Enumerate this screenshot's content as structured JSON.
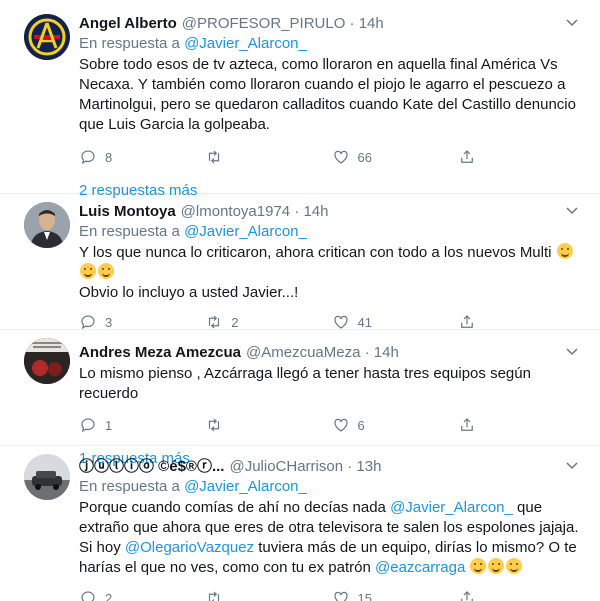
{
  "tweets": [
    {
      "name": "Angel Alberto",
      "handle": "@PROFESOR_PIRULO · 14h",
      "reply_prefix": "En respuesta a",
      "reply_to": "@Javier_Alarcon_",
      "text": "Sobre todo esos de tv azteca, como lloraron en aquella final América Vs Necaxa. Y también como lloraron cuando el piojo le agarro el pescuezo a Martinolgui, pero se quedaron calladitos cuando Kate del Castillo denuncio que Luis Garcia la golpeaba.",
      "replies": "8",
      "retweets": "",
      "likes": "66",
      "more": "2 respuestas más",
      "avatar_icon": "club-america-crest-icon"
    },
    {
      "name": "Luis Montoya",
      "handle": "@lmontoya1974 · 14h",
      "reply_prefix": "En respuesta a",
      "reply_to": "@Javier_Alarcon_",
      "line1": "Y los que nunca lo criticaron, ahora critican con todo a los nuevos Multi",
      "line2": "Obvio lo incluyo a usted Javier...!",
      "replies": "3",
      "retweets": "2",
      "likes": "41",
      "emoji": "grinning-face-emoji"
    },
    {
      "name": "Andres Meza Amezcua",
      "handle": "@AmezcuaMeza · 14h",
      "text": "Lo mismo pienso , Azcárraga llegó a tener hasta tres equipos según recuerdo",
      "replies": "1",
      "retweets": "",
      "likes": "6",
      "more": "1 respuesta más"
    },
    {
      "name": "ⓙⓤⓛⓘⓞ ©é$®ⓡ...",
      "handle": "@JulioCHarrison · 13h",
      "reply_prefix": "En respuesta a",
      "reply_to": "@Javier_Alarcon_",
      "t1": "Porque cuando comías de ahí no decías nada",
      "m1": "@Javier_Alarcon_",
      "t2": "que extraño que ahora que eres de otra televisora te salen los espolones jajaja. Si hoy",
      "m2": "@OlegarioVazquez",
      "t3": "tuviera más de un equipo, dirías lo mismo? O te harías el que no ves, como con tu ex patrón",
      "m3": "@eazcarraga",
      "replies": "2",
      "retweets": "",
      "likes": "15",
      "emoji": "thinking-hushed-face-emoji"
    }
  ],
  "colors": {
    "link": "#1b95e0",
    "muted": "#657786",
    "divider": "#e6ecf0"
  }
}
